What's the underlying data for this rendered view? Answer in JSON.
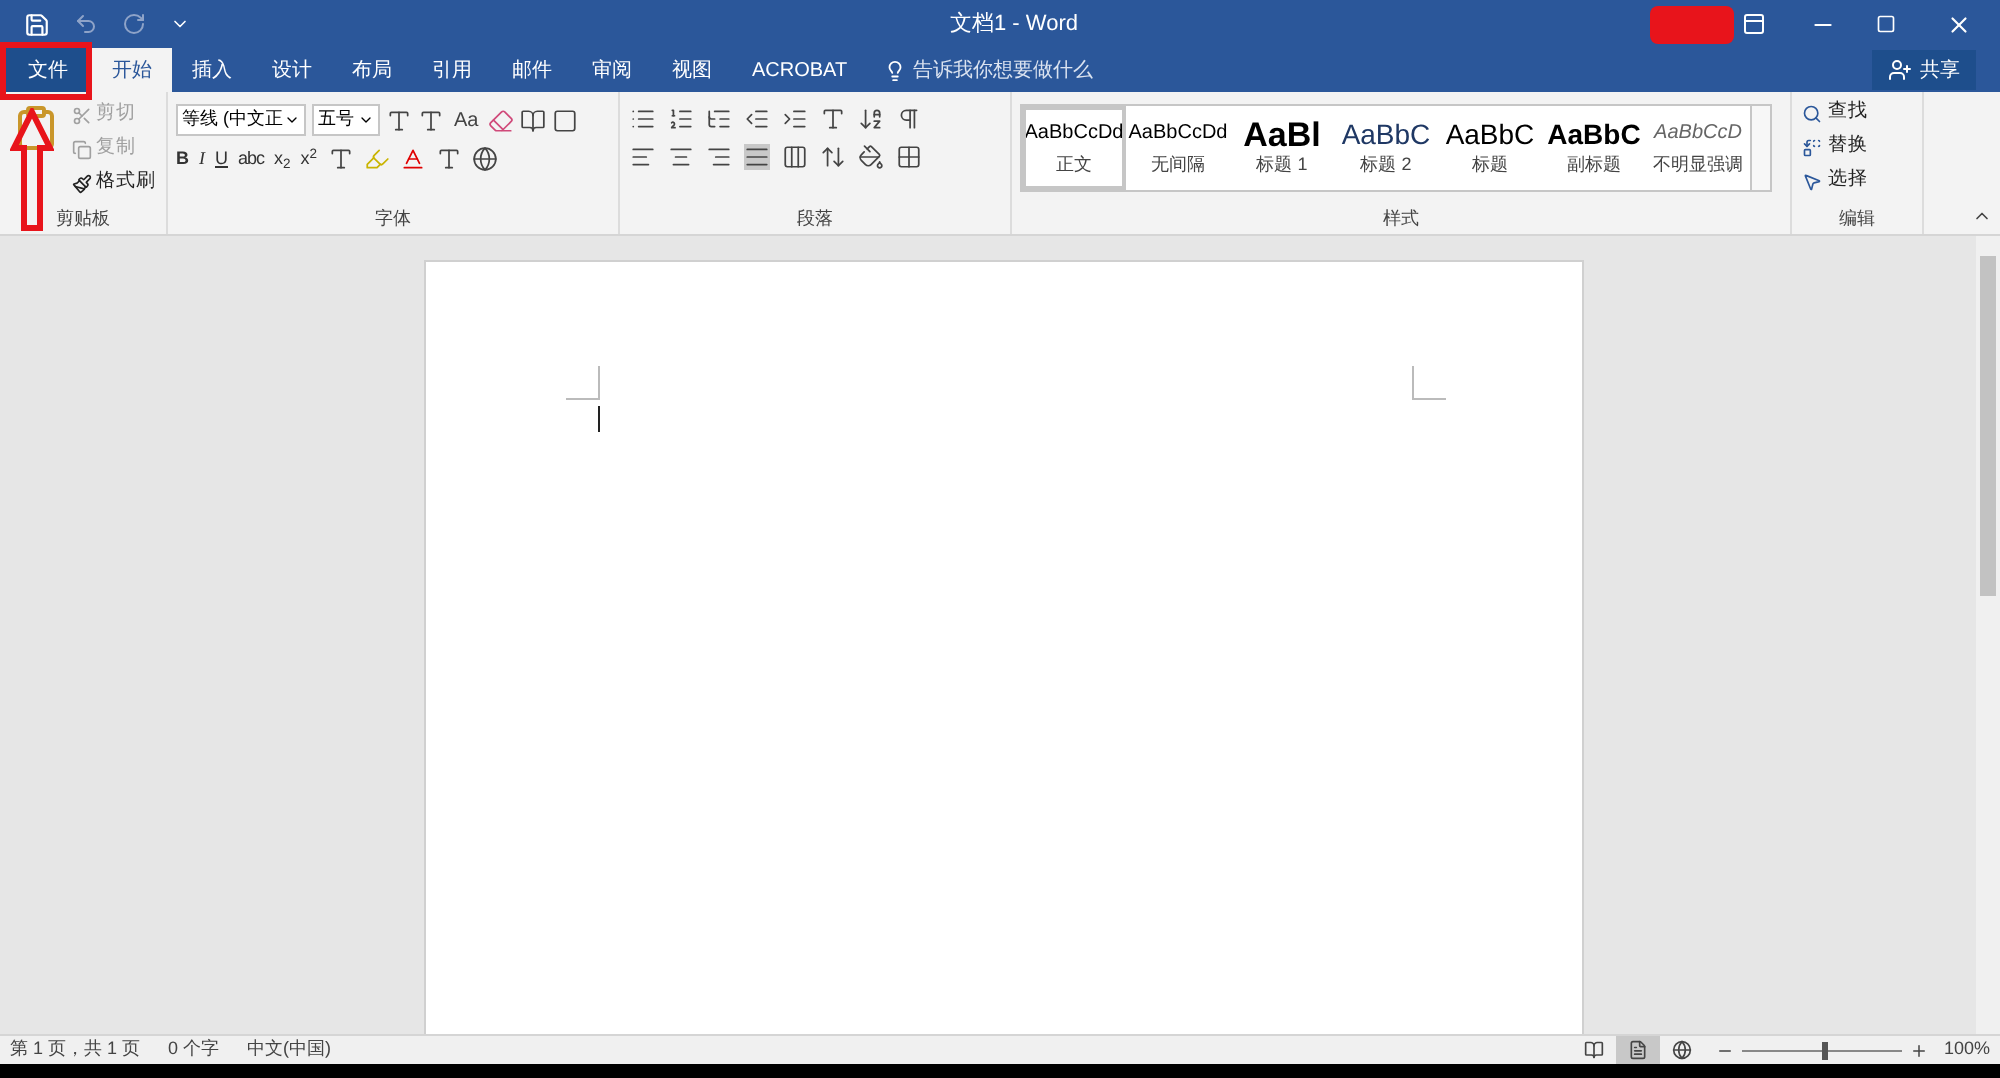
{
  "window": {
    "title": "文档1 - Word"
  },
  "tabs": [
    {
      "label": "文件",
      "kind": "file",
      "selected": false
    },
    {
      "label": "开始",
      "kind": "tab",
      "selected": true
    },
    {
      "label": "插入",
      "kind": "tab",
      "selected": false
    },
    {
      "label": "设计",
      "kind": "tab",
      "selected": false
    },
    {
      "label": "布局",
      "kind": "tab",
      "selected": false
    },
    {
      "label": "引用",
      "kind": "tab",
      "selected": false
    },
    {
      "label": "邮件",
      "kind": "tab",
      "selected": false
    },
    {
      "label": "审阅",
      "kind": "tab",
      "selected": false
    },
    {
      "label": "视图",
      "kind": "tab",
      "selected": false
    },
    {
      "label": "ACROBAT",
      "kind": "tab",
      "selected": false
    }
  ],
  "tell_me": {
    "placeholder": "告诉我你想要做什么"
  },
  "share": "共享",
  "clipboard": {
    "label": "剪贴板",
    "items": [
      {
        "label": "剪切",
        "disabled": true
      },
      {
        "label": "复制",
        "disabled": true
      },
      {
        "label": "格式刷",
        "disabled": false
      }
    ]
  },
  "font": {
    "label": "字体",
    "font_name": "等线 (中文正",
    "font_size": "五号",
    "change_case": "Aa",
    "format_buttons": [
      "B",
      "I",
      "U",
      "abc",
      "x$_{2}$",
      "x$^{2}$"
    ]
  },
  "paragraph": {
    "label": "段落"
  },
  "styles": {
    "label": "样式",
    "items": [
      {
        "preview": "AaBbCcDd",
        "name": "正文",
        "kind": "body",
        "selected": true
      },
      {
        "preview": "AaBbCcDd",
        "name": "无间隔",
        "kind": "body",
        "selected": false
      },
      {
        "preview": "AaBl",
        "name": "标题 1",
        "kind": "heading1",
        "selected": false
      },
      {
        "preview": "AaBbC",
        "name": "标题 2",
        "kind": "heading2",
        "selected": false
      },
      {
        "preview": "AaBbC",
        "name": "标题",
        "kind": "title",
        "selected": false
      },
      {
        "preview": "AaBbC",
        "name": "副标题",
        "kind": "subtitle",
        "selected": false
      },
      {
        "preview": "AaBbCcD",
        "name": "不明显强调",
        "kind": "emphasis",
        "selected": false
      }
    ]
  },
  "editing": {
    "label": "编辑",
    "items": [
      "查找",
      "替换",
      "选择"
    ]
  },
  "status_bar": {
    "items": [
      "第 1 页，共 1 页",
      "0 个字",
      "中文(中国)"
    ],
    "view_modes": [
      {
        "selected": false
      },
      {
        "selected": true
      },
      {
        "selected": false
      }
    ],
    "zoom": {
      "level": 0.5,
      "reading": "100%"
    }
  },
  "annotations": [
    {
      "kind": "box"
    },
    {
      "kind": "arrow"
    },
    {
      "kind": "blot"
    }
  ]
}
